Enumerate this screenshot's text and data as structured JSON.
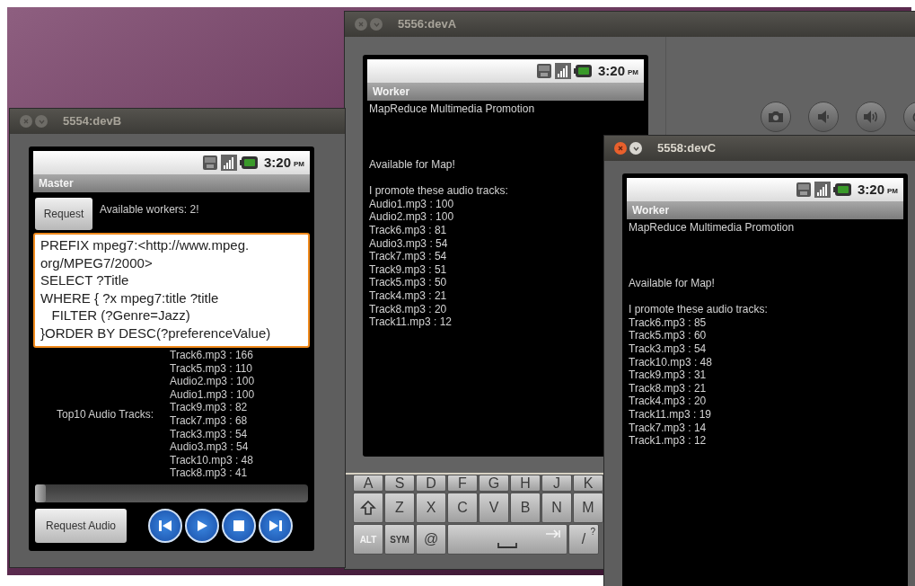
{
  "worker_window_a": {
    "title": "5556:devA",
    "active": false,
    "status_time": "3:20",
    "status_ampm": "PM",
    "app_title": "Worker",
    "heading": "MapReduce Multimedia Promotion",
    "status_text": "Available for Map!",
    "list_label": "I promote these audio tracks:",
    "tracks": [
      "Audio1.mp3 : 100",
      "Audio2.mp3 : 100",
      "Track6.mp3 : 81",
      "Audio3.mp3 : 54",
      "Track7.mp3 : 54",
      "Track9.mp3 : 51",
      "Track5.mp3 : 50",
      "Track4.mp3 : 21",
      "Track8.mp3 : 20",
      "Track11.mp3 : 12"
    ],
    "keyboard": [
      [
        {
          "kind": "key",
          "label": "A"
        },
        {
          "kind": "key",
          "label": "S"
        },
        {
          "kind": "key",
          "label": "D"
        },
        {
          "kind": "key",
          "label": "F"
        },
        {
          "kind": "key",
          "label": "G"
        },
        {
          "kind": "key",
          "label": "H"
        },
        {
          "kind": "key",
          "label": "J"
        },
        {
          "kind": "key",
          "label": "K"
        }
      ],
      [
        {
          "kind": "shift"
        },
        {
          "kind": "key",
          "label": "Z"
        },
        {
          "kind": "key",
          "label": "X"
        },
        {
          "kind": "key",
          "label": "C"
        },
        {
          "kind": "key",
          "label": "V"
        },
        {
          "kind": "key",
          "label": "B"
        },
        {
          "kind": "key",
          "label": "N"
        },
        {
          "kind": "key",
          "label": "M"
        }
      ],
      [
        {
          "kind": "alt",
          "label": "ALT"
        },
        {
          "kind": "sym",
          "label": "SYM"
        },
        {
          "kind": "key",
          "label": "@"
        },
        {
          "kind": "space"
        },
        {
          "kind": "key",
          "label": "/",
          "alt": "?"
        }
      ]
    ]
  },
  "master_window": {
    "title": "5554:devB",
    "active": false,
    "status_time": "3:20",
    "status_ampm": "PM",
    "app_title": "Master",
    "request_button": "Request",
    "workers_text": "Available workers: 2!",
    "query": "PREFIX mpeg7:<http://www.mpeg.\norg/MPEG7/2000>\nSELECT ?Title\nWHERE { ?x mpeg7:title ?title\n   FILTER (?Genre=Jazz)\n}ORDER BY DESC(?preferenceValue)",
    "top10_label": "Top10 Audio Tracks:",
    "top10": [
      "Track6.mp3 : 166",
      "Track5.mp3 : 110",
      "Audio2.mp3 : 100",
      "Audio1.mp3 : 100",
      "Track9.mp3 : 82",
      "Track7.mp3 : 68",
      "Track3.mp3 : 54",
      "Audio3.mp3 : 54",
      "Track10.mp3 : 48",
      "Track8.mp3 : 41"
    ],
    "seek_bar": {
      "level": 0
    },
    "request_audio_button": "Request Audio"
  },
  "worker_window_c": {
    "title": "5558:devC",
    "active": true,
    "status_time": "3:20",
    "status_ampm": "PM",
    "app_title": "Worker",
    "heading": "MapReduce Multimedia Promotion",
    "status_text": "Available for Map!",
    "list_label": "I promote these audio tracks:",
    "tracks": [
      "Track6.mp3 : 85",
      "Track5.mp3 : 60",
      "Track3.mp3 : 54",
      "Track10.mp3 : 48",
      "Track9.mp3 : 31",
      "Track8.mp3 : 21",
      "Track4.mp3 : 20",
      "Track11.mp3 : 19",
      "Track7.mp3 : 14",
      "Track1.mp3 : 12"
    ]
  }
}
